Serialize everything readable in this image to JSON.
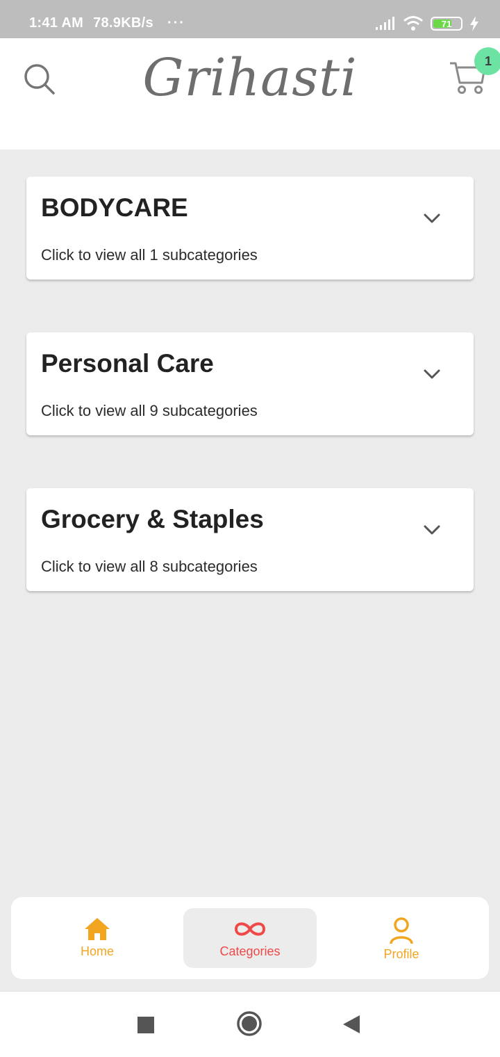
{
  "status_bar": {
    "time": "1:41 AM",
    "speed": "78.9KB/s",
    "dots": "···",
    "battery_level": "71",
    "battery_percent": 71,
    "icons": [
      "signal-icon",
      "wifi-icon",
      "battery-icon",
      "charging-icon"
    ]
  },
  "header": {
    "logo_text": "Grihasti",
    "search_icon": "search-icon",
    "cart_icon": "cart-icon",
    "cart_count": "1"
  },
  "categories": [
    {
      "title": "BODYCARE",
      "subtitle": "Click to view all 1 subcategories"
    },
    {
      "title": "Personal Care",
      "subtitle": "Click to view all 9 subcategories"
    },
    {
      "title": "Grocery & Staples",
      "subtitle": "Click to view all 8 subcategories"
    }
  ],
  "bottom_nav": {
    "items": [
      {
        "label": "Home",
        "icon": "home-icon",
        "color": "#f2a521"
      },
      {
        "label": "Categories",
        "icon": "infinity-icon",
        "color": "#ef4848",
        "active": true
      },
      {
        "label": "Profile",
        "icon": "profile-icon",
        "color": "#f2a521"
      }
    ]
  },
  "system_nav": {
    "icons": [
      "recents-square-icon",
      "home-circle-icon",
      "back-triangle-icon"
    ]
  },
  "colors": {
    "accent_orange": "#f2a521",
    "accent_red": "#ef4848",
    "badge_green": "#6ce3a3",
    "background": "#ececec"
  }
}
